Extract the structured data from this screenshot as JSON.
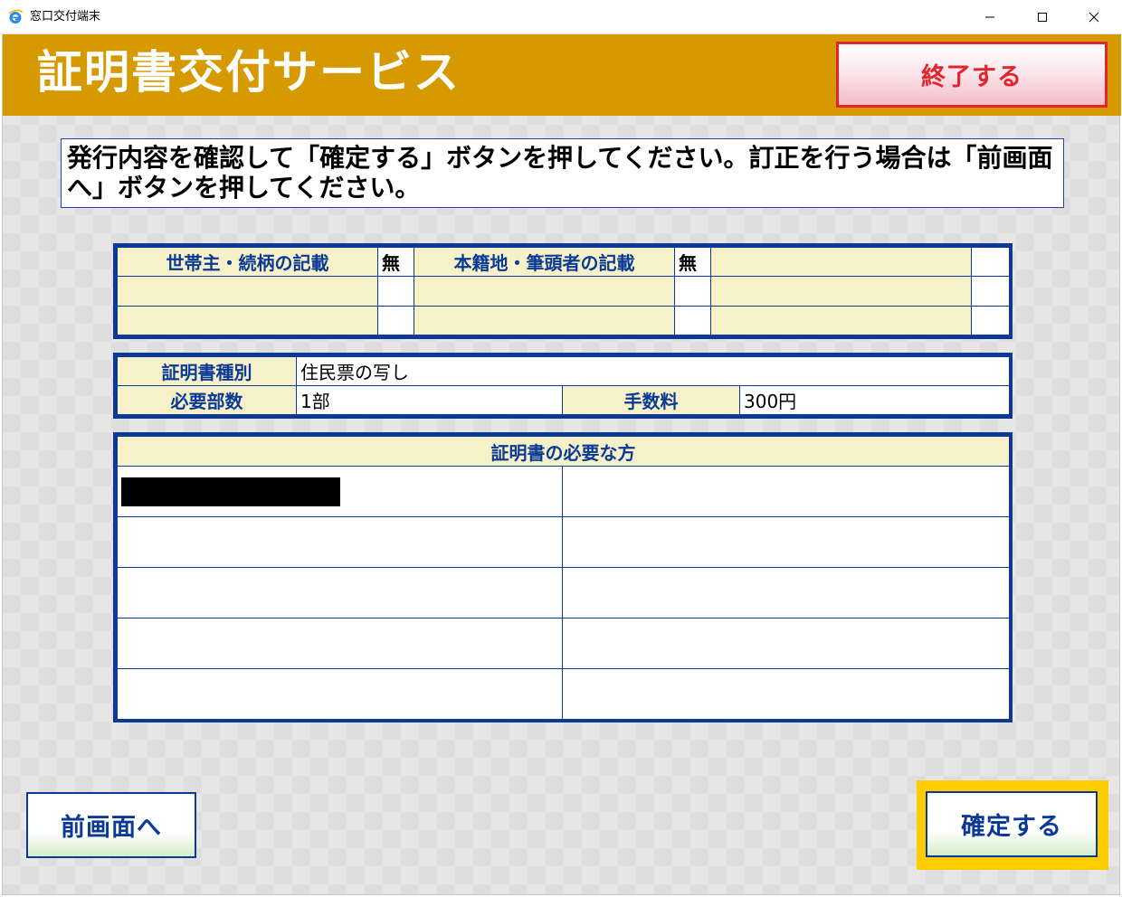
{
  "window": {
    "title": "窓口交付端末",
    "icon": "ie-e-icon"
  },
  "header": {
    "title": "証明書交付サービス",
    "end_button": "終了する"
  },
  "instruction": "発行内容を確認して「確定する」ボタンを押してください。訂正を行う場合は「前画面へ」ボタンを押してください。",
  "records": {
    "household_label": "世帯主・続柄の記載",
    "household_value": "無",
    "domicile_label": "本籍地・筆頭者の記載",
    "domicile_value": "無"
  },
  "certificate": {
    "type_label": "証明書種別",
    "type_value": "住民票の写し",
    "copies_label": "必要部数",
    "copies_value": "1部",
    "fee_label": "手数料",
    "fee_value": "300円"
  },
  "persons": {
    "header": "証明書の必要な方",
    "rows": 5
  },
  "footer": {
    "prev_button": "前画面へ",
    "confirm_button": "確定する"
  },
  "colors": {
    "header_band": "#d69a00",
    "label_bg": "#f6f1c8",
    "border_blue": "#0a3a96",
    "end_red": "#e0252e",
    "confirm_highlight": "#ffcc00"
  }
}
